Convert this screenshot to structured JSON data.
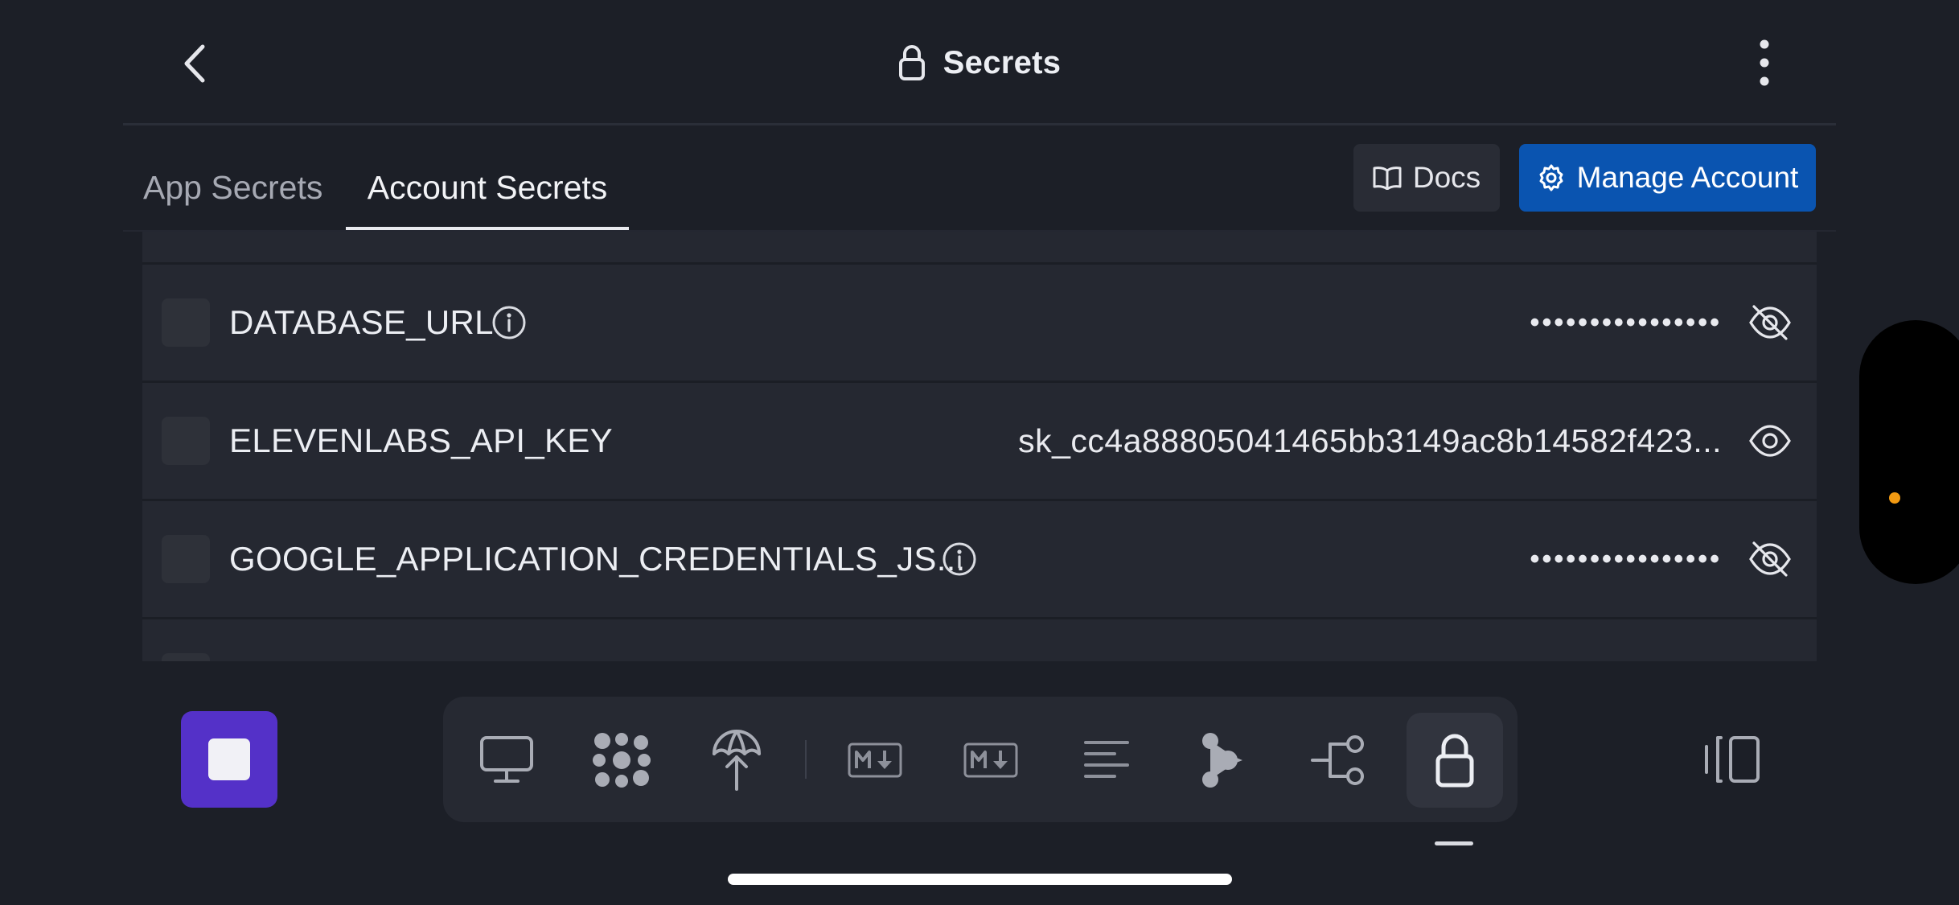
{
  "header": {
    "title": "Secrets"
  },
  "tabs": [
    {
      "label": "App Secrets",
      "active": false
    },
    {
      "label": "Account Secrets",
      "active": true
    }
  ],
  "actions": {
    "docs_label": "Docs",
    "manage_label": "Manage Account"
  },
  "secrets": [
    {
      "key": "DATABASE_URL",
      "value": "••••••••••••••••",
      "masked": true,
      "info": true
    },
    {
      "key": "ELEVENLABS_API_KEY",
      "value": "sk_cc4a88805041465bb3149ac8b14582f423...",
      "masked": false,
      "info": false
    },
    {
      "key": "GOOGLE_APPLICATION_CREDENTIALS_JS...",
      "value": "••••••••••••••••",
      "masked": true,
      "info": true
    }
  ],
  "toolbar": {
    "items": [
      "monitor-icon",
      "sparkle-cluster-icon",
      "deploy-icon",
      "markdown-icon",
      "markdown-icon",
      "text-align-left-icon",
      "branch-icon",
      "git-flow-icon",
      "lock-icon"
    ],
    "active": "lock-icon"
  },
  "colors": {
    "background": "#1c1f27",
    "accent": "#0a54b0",
    "stop_button": "#5431c8",
    "side_dot": "#f29a12"
  }
}
